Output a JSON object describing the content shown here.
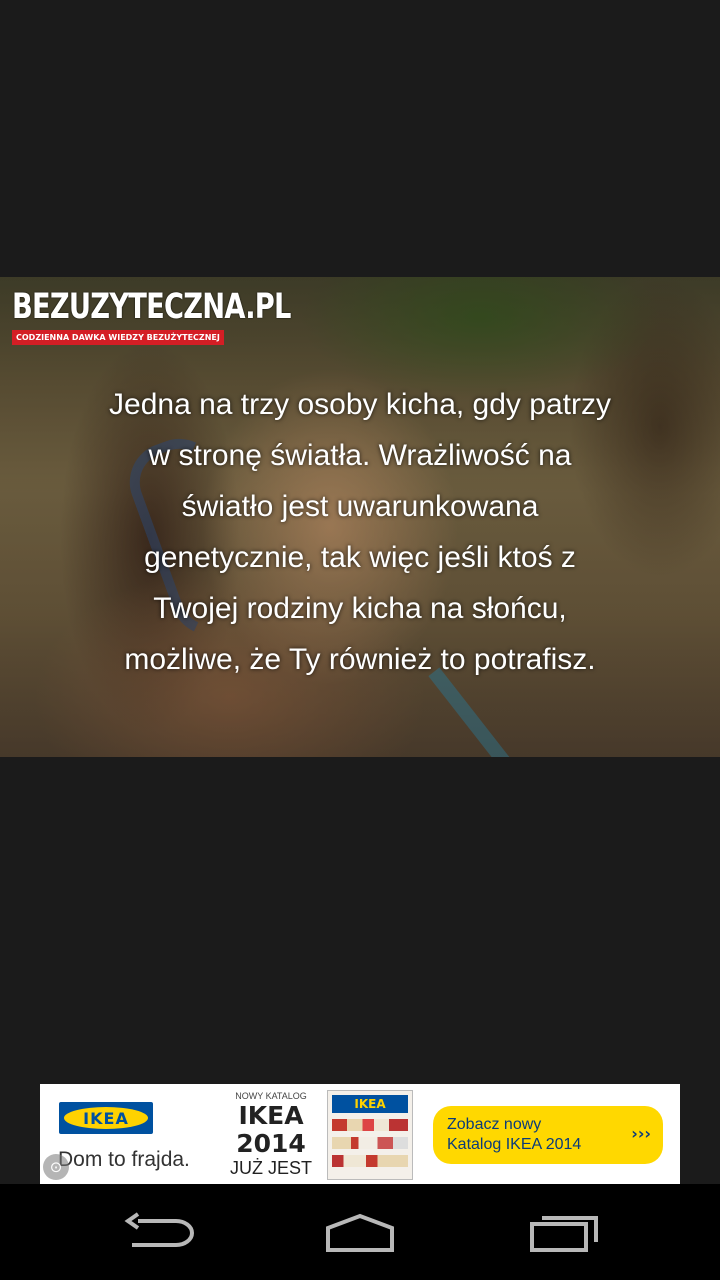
{
  "brand": {
    "name": "BEZUZYTECZNA.PL",
    "tagline": "CODZIENNA DAWKA WIEDZY BEZUŻYTECZNEJ"
  },
  "quote": {
    "lines": [
      "Jedna na trzy osoby kicha, gdy patrzy",
      "w stronę światła. Wrażliwość na",
      "światło jest uwarunkowana",
      "genetycznie, tak więc jeśli ktoś z",
      "Twojej rodziny kicha na słońcu,",
      "możliwe, że Ty również to potrafisz."
    ]
  },
  "ad": {
    "logo_text": "IKEA",
    "slogan": "Dom to frajda.",
    "catalog_small": "NOWY KATALOG",
    "catalog_brand": "IKEA",
    "catalog_year": "2014",
    "catalog_status": "JUŻ JEST",
    "catalog_cover_label": "IKEA",
    "cta_line1": "Zobacz nowy",
    "cta_line2": "Katalog IKEA 2014",
    "cta_arrows": "›››",
    "info_icon": "info-icon"
  },
  "navbar": {
    "icons": [
      "back-icon",
      "home-icon",
      "recent-apps-icon"
    ]
  },
  "colors": {
    "background": "#1b1b1b",
    "brand_red": "#d41e25",
    "ikea_blue": "#0051a0",
    "ikea_yellow": "#ffd200"
  }
}
